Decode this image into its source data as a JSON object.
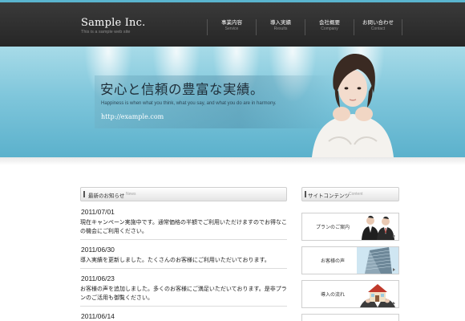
{
  "header": {
    "logo": "Sample Inc.",
    "tagline": "This is a sample web site",
    "nav": [
      {
        "label": "事業内容",
        "sub": "Service"
      },
      {
        "label": "導入実績",
        "sub": "Results"
      },
      {
        "label": "会社概要",
        "sub": "Company"
      },
      {
        "label": "お問い合わせ",
        "sub": "Contact"
      }
    ]
  },
  "hero": {
    "heading": "安心と信頼の豊富な実績。",
    "subheading": "Happiness is when what you think, what you say, and what you do are in harmony.",
    "url": "http://example.com"
  },
  "news": {
    "title": "最新のお知らせ",
    "title_en": "News",
    "items": [
      {
        "date": "2011/07/01",
        "line1": "現在キャンペーン実施中です。通常価格の半額でご利用いただけますのでお得なこ",
        "line2": "の機会にご利用ください。"
      },
      {
        "date": "2011/06/30",
        "line1": "導入実績を更新しました。たくさんのお客様にご利用いただいております。",
        "line2": ""
      },
      {
        "date": "2011/06/23",
        "line1": "お客様の声を追加しました。多くのお客様にご満足いただいております。是非プラ",
        "line2": "ンのご活用も御覧ください。"
      },
      {
        "date": "2011/06/14",
        "line1": "",
        "line2": ""
      }
    ]
  },
  "sidebar": {
    "title": "サイトコンテンツ",
    "title_en": "Content",
    "banners": [
      {
        "label": "プランのご案内",
        "icon": "businessmen-image"
      },
      {
        "label": "お客様の声",
        "icon": "office-building-image"
      },
      {
        "label": "導入の流れ",
        "icon": "house-model-image"
      }
    ]
  },
  "colors": {
    "header_bg": "#2c2c2c",
    "accent": "#5ab5cf",
    "hero_bg": "#7fc6db"
  }
}
